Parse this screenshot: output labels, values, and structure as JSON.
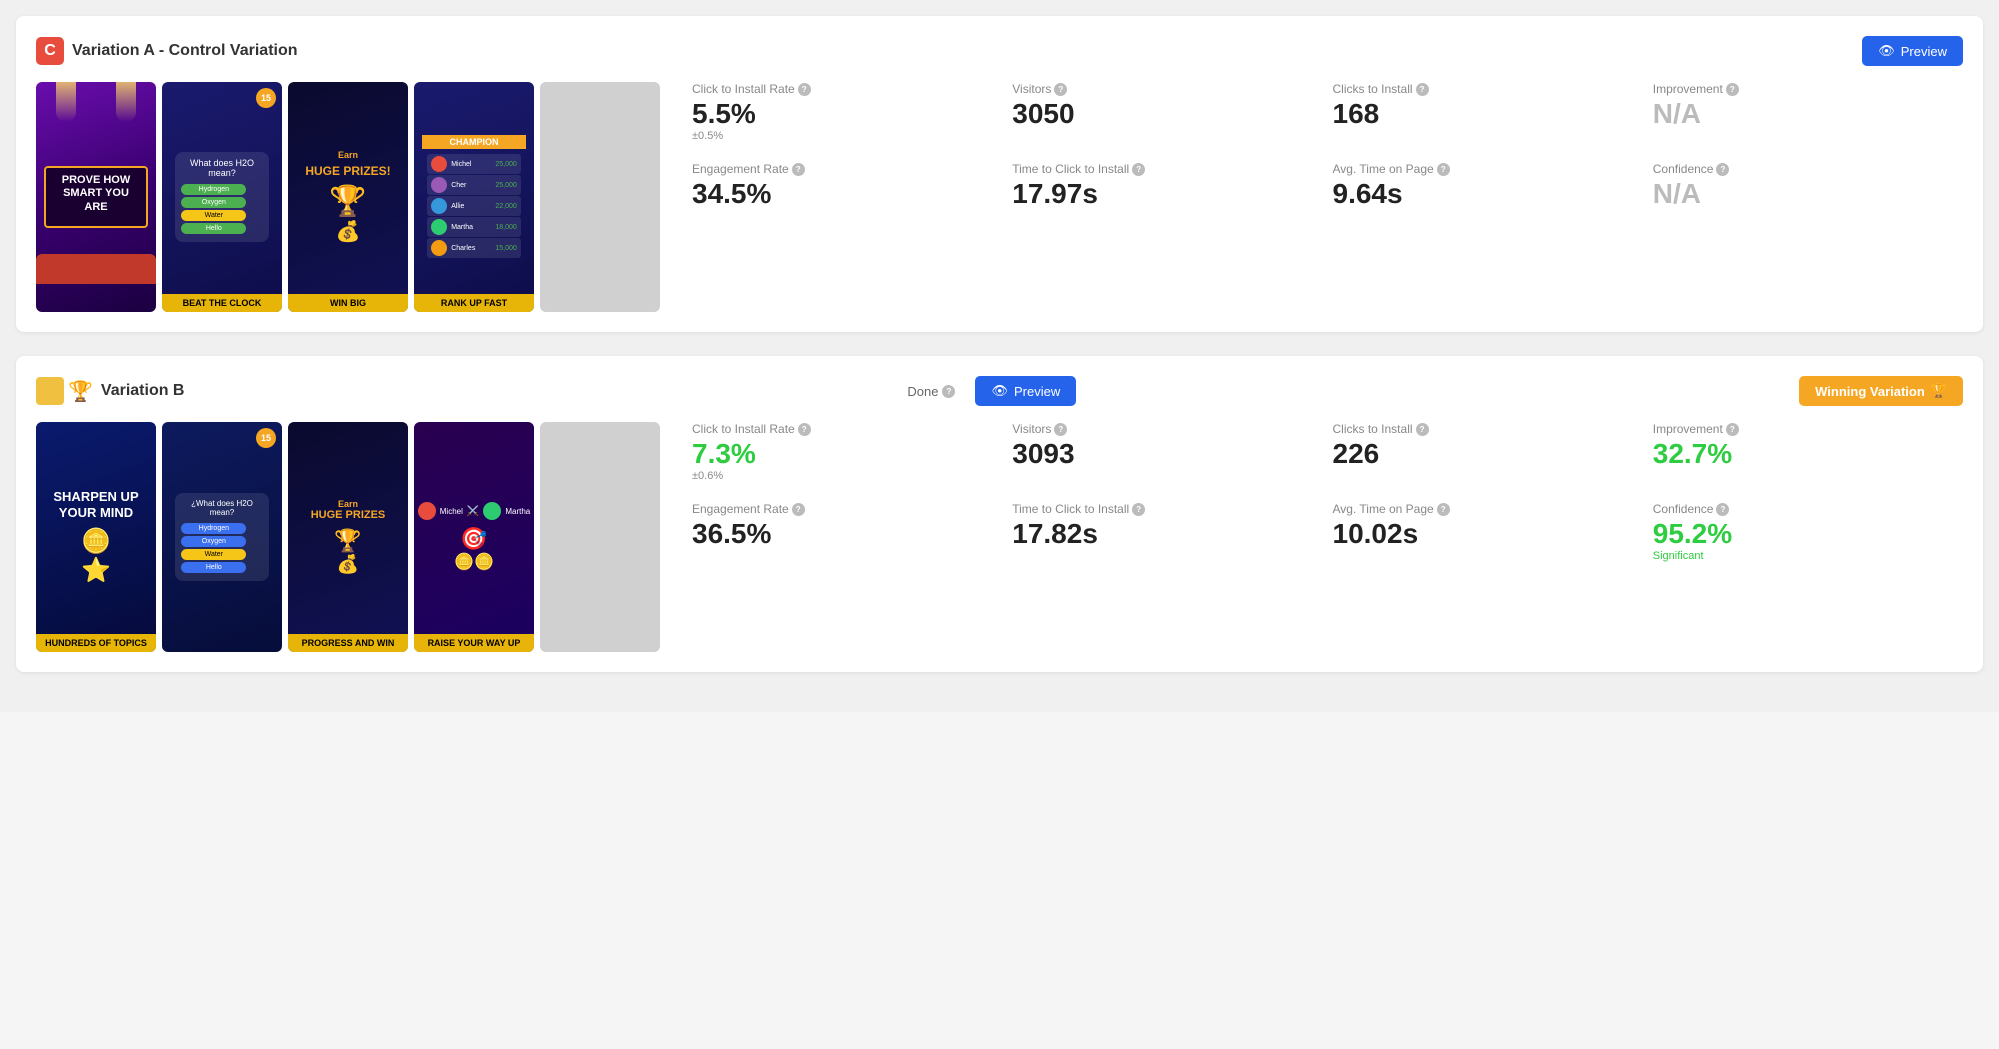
{
  "variationA": {
    "icon": "C",
    "title": "Variation A - Control Variation",
    "preview_btn": "Preview",
    "screenshots": [
      {
        "label": "",
        "type": "a1",
        "main_text": "PROVE HOW SMART YOU ARE",
        "sub": ""
      },
      {
        "label": "BEAT THE CLOCK",
        "type": "a2",
        "main_text": "What does H2O mean?",
        "sub": ""
      },
      {
        "label": "WIN BIG",
        "type": "a3",
        "main_text": "Earn HUGE PRIZES!",
        "sub": ""
      },
      {
        "label": "RANK UP FAST",
        "type": "a4",
        "main_text": "CHAMPION",
        "sub": ""
      },
      {
        "label": "",
        "type": "a5",
        "main_text": "",
        "sub": ""
      }
    ],
    "stats": {
      "row1": [
        {
          "label": "Click to Install Rate",
          "value": "5.5%",
          "sub": "±0.5%",
          "color": "normal",
          "has_q": true
        },
        {
          "label": "Visitors",
          "value": "3050",
          "sub": "",
          "color": "normal",
          "has_q": true
        },
        {
          "label": "Clicks to Install",
          "value": "168",
          "sub": "",
          "color": "normal",
          "has_q": true
        },
        {
          "label": "Improvement",
          "value": "N/A",
          "sub": "",
          "color": "gray",
          "has_q": true
        }
      ],
      "row2": [
        {
          "label": "Engagement Rate",
          "value": "34.5%",
          "sub": "",
          "color": "normal",
          "has_q": true
        },
        {
          "label": "Time to Click to Install",
          "value": "17.97s",
          "sub": "",
          "color": "normal",
          "has_q": true
        },
        {
          "label": "Avg. Time on Page",
          "value": "9.64s",
          "sub": "",
          "color": "normal",
          "has_q": true
        },
        {
          "label": "Confidence",
          "value": "N/A",
          "sub": "",
          "color": "gray",
          "has_q": true
        }
      ]
    }
  },
  "variationB": {
    "title": "Variation B",
    "preview_btn": "Preview",
    "done_label": "Done",
    "winning_label": "Winning Variation",
    "screenshots": [
      {
        "label": "HUNDREDS OF TOPICS",
        "type": "b1",
        "main_text": "SHARPEN UP YOUR MIND",
        "sub": ""
      },
      {
        "label": "",
        "type": "b2",
        "main_text": "¿What does H2O mean?",
        "sub": ""
      },
      {
        "label": "PROGRESS AND WIN",
        "type": "b3",
        "main_text": "Earn HUGE PRIZES",
        "sub": ""
      },
      {
        "label": "RAISE YOUR WAY UP",
        "type": "b4",
        "main_text": "Michel vs Martha",
        "sub": ""
      },
      {
        "label": "",
        "type": "b5",
        "main_text": "",
        "sub": ""
      }
    ],
    "stats": {
      "row1": [
        {
          "label": "Click to Install Rate",
          "value": "7.3%",
          "sub": "±0.6%",
          "color": "green",
          "has_q": true
        },
        {
          "label": "Visitors",
          "value": "3093",
          "sub": "",
          "color": "normal",
          "has_q": true
        },
        {
          "label": "Clicks to Install",
          "value": "226",
          "sub": "",
          "color": "normal",
          "has_q": true
        },
        {
          "label": "Improvement",
          "value": "32.7%",
          "sub": "",
          "color": "green",
          "has_q": true
        }
      ],
      "row2": [
        {
          "label": "Engagement Rate",
          "value": "36.5%",
          "sub": "",
          "color": "normal",
          "has_q": true
        },
        {
          "label": "Time to Click to Install",
          "value": "17.82s",
          "sub": "",
          "color": "normal",
          "has_q": true
        },
        {
          "label": "Avg. Time on Page",
          "value": "10.02s",
          "sub": "",
          "color": "normal",
          "has_q": true
        },
        {
          "label": "Confidence",
          "value": "95.2%",
          "sub": "Significant",
          "color": "green",
          "has_q": true
        }
      ]
    }
  }
}
